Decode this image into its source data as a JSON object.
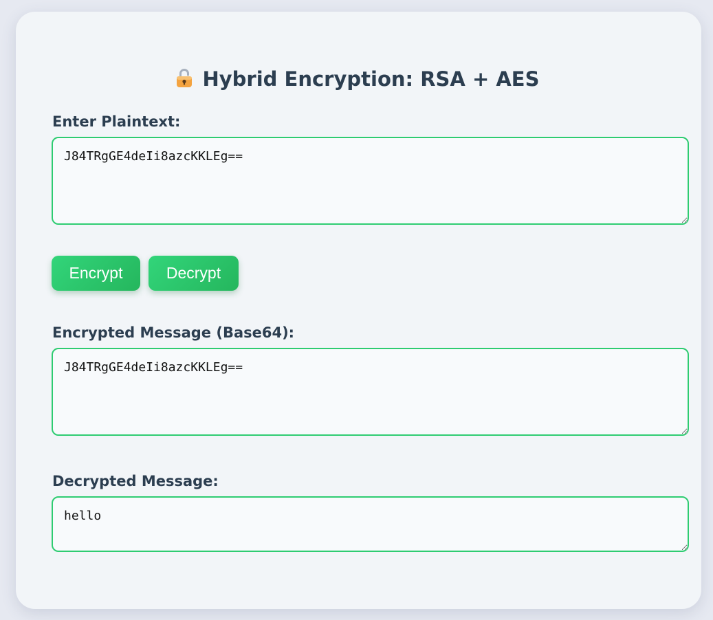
{
  "page": {
    "title": "Hybrid Encryption: RSA + AES",
    "title_icon": "lock-icon"
  },
  "plaintext": {
    "label": "Enter Plaintext:",
    "value": "J84TRgGE4deIi8azcKKLEg=="
  },
  "actions": {
    "encrypt_label": "Encrypt",
    "decrypt_label": "Decrypt"
  },
  "encrypted": {
    "label": "Encrypted Message (Base64):",
    "value": "J84TRgGE4deIi8azcKKLEg=="
  },
  "decrypted": {
    "label": "Decrypted Message:",
    "value": "hello"
  },
  "colors": {
    "accent": "#2ecc71",
    "text": "#2c3e50",
    "card": "#f2f5f8",
    "background": "#e6e9f1"
  }
}
